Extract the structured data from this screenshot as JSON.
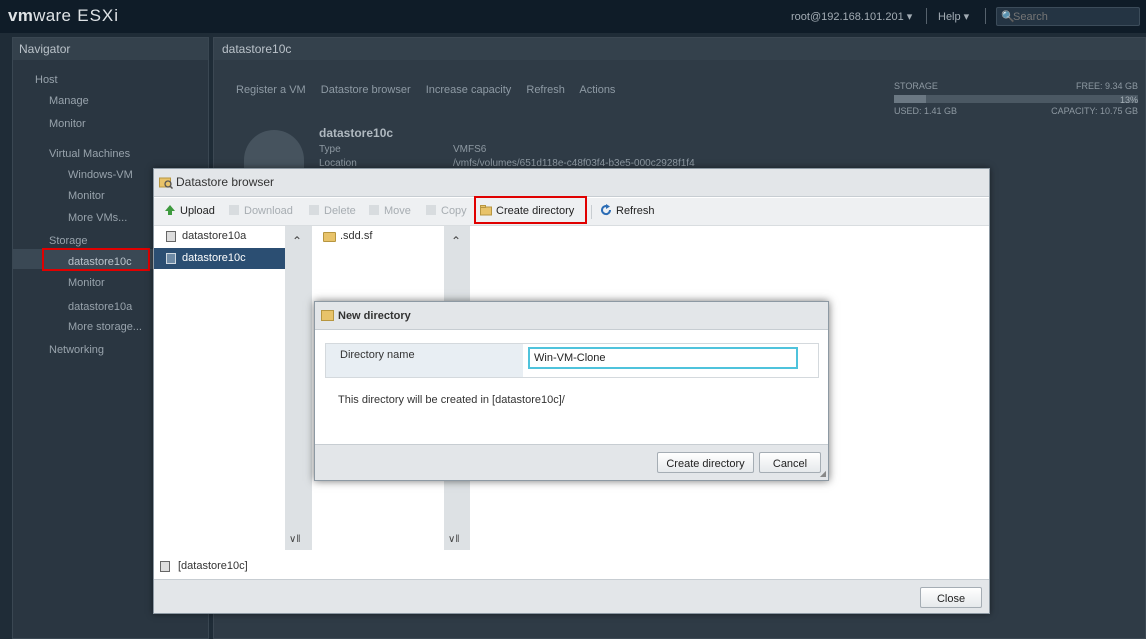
{
  "topbar": {
    "brand_vm": "vm",
    "brand_ware": "ware",
    "brand_product": "ESXi",
    "user": "root@192.168.101.201 ▾",
    "help": "Help ▾",
    "search_placeholder": "Search"
  },
  "navigator": {
    "title": "Navigator",
    "items": [
      {
        "label": "Host"
      },
      {
        "label": "Manage"
      },
      {
        "label": "Monitor"
      },
      {
        "label": "Virtual Machines"
      },
      {
        "label": "Windows-VM"
      },
      {
        "label": "Monitor"
      },
      {
        "label": "More VMs..."
      },
      {
        "label": "Storage"
      },
      {
        "label": "datastore10c"
      },
      {
        "label": "Monitor"
      },
      {
        "label": "datastore10a"
      },
      {
        "label": "More storage..."
      },
      {
        "label": "Networking"
      }
    ]
  },
  "main": {
    "title": "datastore10c",
    "toolbar": [
      "Register a VM",
      "Datastore browser",
      "Increase capacity",
      "Refresh",
      "Actions"
    ],
    "storage": {
      "label": "STORAGE",
      "free": "FREE: 9.34 GB",
      "used": "USED: 1.41 GB",
      "capacity": "CAPACITY: 10.75 GB",
      "used_fraction": 0.13,
      "percent": "13%"
    },
    "ds_name": "datastore10c",
    "ds_type_label": "Type",
    "ds_type": "VMFS6",
    "ds_location_label": "Location",
    "ds_location": "/vmfs/volumes/651d118e-c48f03f4-b3e5-000c2928f1f4"
  },
  "browser": {
    "title": "Datastore browser",
    "toolbar": {
      "upload": "Upload",
      "download": "Download",
      "delete": "Delete",
      "move": "Move",
      "copy": "Copy",
      "create_directory": "Create directory",
      "refresh": "Refresh"
    },
    "datastores": [
      "datastore10a",
      "datastore10c"
    ],
    "selected_datastore": "datastore10c",
    "files": [
      ".sdd.sf"
    ],
    "path": "[datastore10c]",
    "close_label": "Close"
  },
  "new_directory": {
    "title": "New directory",
    "field_label": "Directory name",
    "field_value": "Win-VM-Clone",
    "info": "This directory will be created in [datastore10c]/",
    "create_label": "Create directory",
    "cancel_label": "Cancel"
  },
  "colors": {
    "highlight_box": "#e00000",
    "selection": "#2b4e72",
    "input_focus": "#4fc3dc"
  }
}
